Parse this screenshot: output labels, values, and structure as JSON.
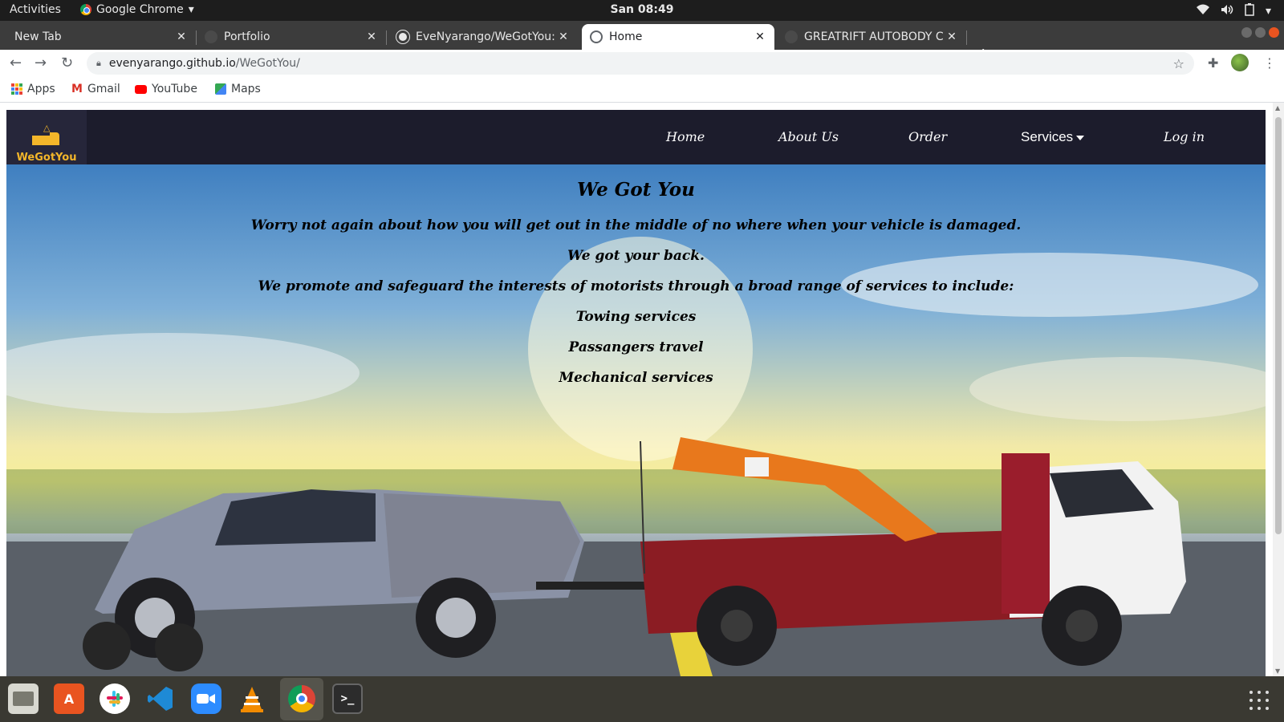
{
  "topbar": {
    "activities": "Activities",
    "app": "Google Chrome",
    "clock": "San 08:49"
  },
  "tabs": [
    {
      "title": "New Tab"
    },
    {
      "title": "Portfolio"
    },
    {
      "title": "EveNyarango/WeGotYou:"
    },
    {
      "title": "Home"
    },
    {
      "title": "GREATRIFT AUTOBODY C"
    }
  ],
  "omnibox": {
    "host": "evenyarango.github.io",
    "path": "/WeGotYou/"
  },
  "bookmarks": [
    "Apps",
    "Gmail",
    "YouTube",
    "Maps"
  ],
  "site": {
    "logo_text": "WeGotYou",
    "nav": {
      "home": "Home",
      "about": "About Us",
      "order": "Order",
      "services": "Services",
      "login": "Log in"
    }
  },
  "hero": {
    "title": "We Got You",
    "line1": "Worry not again about how you will get out in the middle of no where when your vehicle is damaged.",
    "line2": "We got your back.",
    "line3": "We promote and safeguard the interests of motorists through a broad range of services to include:",
    "services": [
      "Towing services",
      "Passangers travel",
      "Mechanical services"
    ]
  },
  "dock_apps": [
    "files-icon",
    "software-icon",
    "slack-icon",
    "vscode-icon",
    "zoom-icon",
    "vlc-icon",
    "chrome-icon",
    "terminal-icon"
  ]
}
